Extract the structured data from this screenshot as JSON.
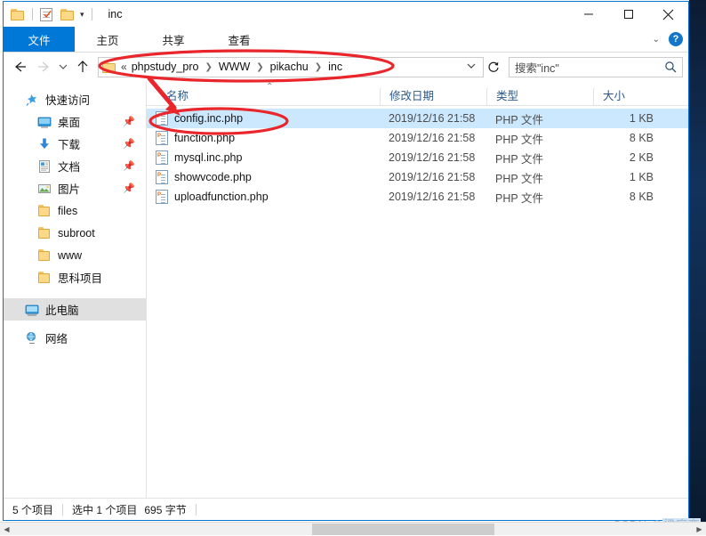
{
  "window": {
    "title": "inc",
    "quick_access_icons": [
      "folder-icon",
      "properties-icon",
      "new-folder-icon",
      "customize-caret-icon"
    ],
    "controls": {
      "minimize": "minimize-button",
      "maximize": "maximize-button",
      "close": "close-button"
    }
  },
  "ribbon": {
    "tabs": [
      {
        "label": "文件",
        "active": true
      },
      {
        "label": "主页",
        "active": false
      },
      {
        "label": "共享",
        "active": false
      },
      {
        "label": "查看",
        "active": false
      }
    ],
    "expand_caret": "⌄",
    "help_label": "?"
  },
  "navbar": {
    "back": "←",
    "forward": "→",
    "recent_caret": "⌄",
    "up": "↑",
    "address": {
      "leading": "«",
      "crumbs": [
        "phpstudy_pro",
        "WWW",
        "pikachu",
        "inc"
      ],
      "dropdown_caret": "⌄"
    },
    "refresh": "↻",
    "search": {
      "placeholder": "搜索\"inc\"",
      "icon": "search-icon"
    }
  },
  "sidebar": {
    "groups": [
      {
        "label": "快速访问",
        "icon": "star-pin-icon",
        "items": [
          {
            "label": "桌面",
            "icon": "desktop-icon",
            "pinned": true
          },
          {
            "label": "下载",
            "icon": "download-icon",
            "pinned": true
          },
          {
            "label": "文档",
            "icon": "documents-icon",
            "pinned": true
          },
          {
            "label": "图片",
            "icon": "pictures-icon",
            "pinned": true
          },
          {
            "label": "files",
            "icon": "folder-icon",
            "pinned": false
          },
          {
            "label": "subroot",
            "icon": "folder-icon",
            "pinned": false
          },
          {
            "label": "www",
            "icon": "folder-icon",
            "pinned": false
          },
          {
            "label": "思科项目",
            "icon": "folder-icon",
            "pinned": false
          }
        ]
      }
    ],
    "roots": [
      {
        "label": "此电脑",
        "icon": "this-pc-icon",
        "selected": true
      },
      {
        "label": "网络",
        "icon": "network-icon",
        "selected": false
      }
    ]
  },
  "filelist": {
    "columns": [
      {
        "key": "name",
        "label": "名称"
      },
      {
        "key": "date",
        "label": "修改日期"
      },
      {
        "key": "type",
        "label": "类型"
      },
      {
        "key": "size",
        "label": "大小"
      }
    ],
    "sort_indicator": "⌃",
    "rows": [
      {
        "name": "config.inc.php",
        "date": "2019/12/16 21:58",
        "type": "PHP 文件",
        "size": "1 KB",
        "selected": true,
        "icon": "php-file-icon"
      },
      {
        "name": "function.php",
        "date": "2019/12/16 21:58",
        "type": "PHP 文件",
        "size": "8 KB",
        "selected": false,
        "icon": "php-file-icon"
      },
      {
        "name": "mysql.inc.php",
        "date": "2019/12/16 21:58",
        "type": "PHP 文件",
        "size": "2 KB",
        "selected": false,
        "icon": "php-file-icon"
      },
      {
        "name": "showvcode.php",
        "date": "2019/12/16 21:58",
        "type": "PHP 文件",
        "size": "1 KB",
        "selected": false,
        "icon": "php-file-icon"
      },
      {
        "name": "uploadfunction.php",
        "date": "2019/12/16 21:58",
        "type": "PHP 文件",
        "size": "8 KB",
        "selected": false,
        "icon": "php-file-icon"
      }
    ]
  },
  "statusbar": {
    "item_count": "5 个项目",
    "selection": "选中 1 个项目",
    "selection_size": "695 字节"
  },
  "watermark": {
    "prefix": "CSDN @",
    "user": "梁庭奕"
  },
  "annotations": {
    "accent_color": "#e8262b",
    "ellipse_address_label": "address-path-highlight",
    "ellipse_file_label": "config-file-highlight",
    "arrow_label": "pointer-arrow"
  }
}
